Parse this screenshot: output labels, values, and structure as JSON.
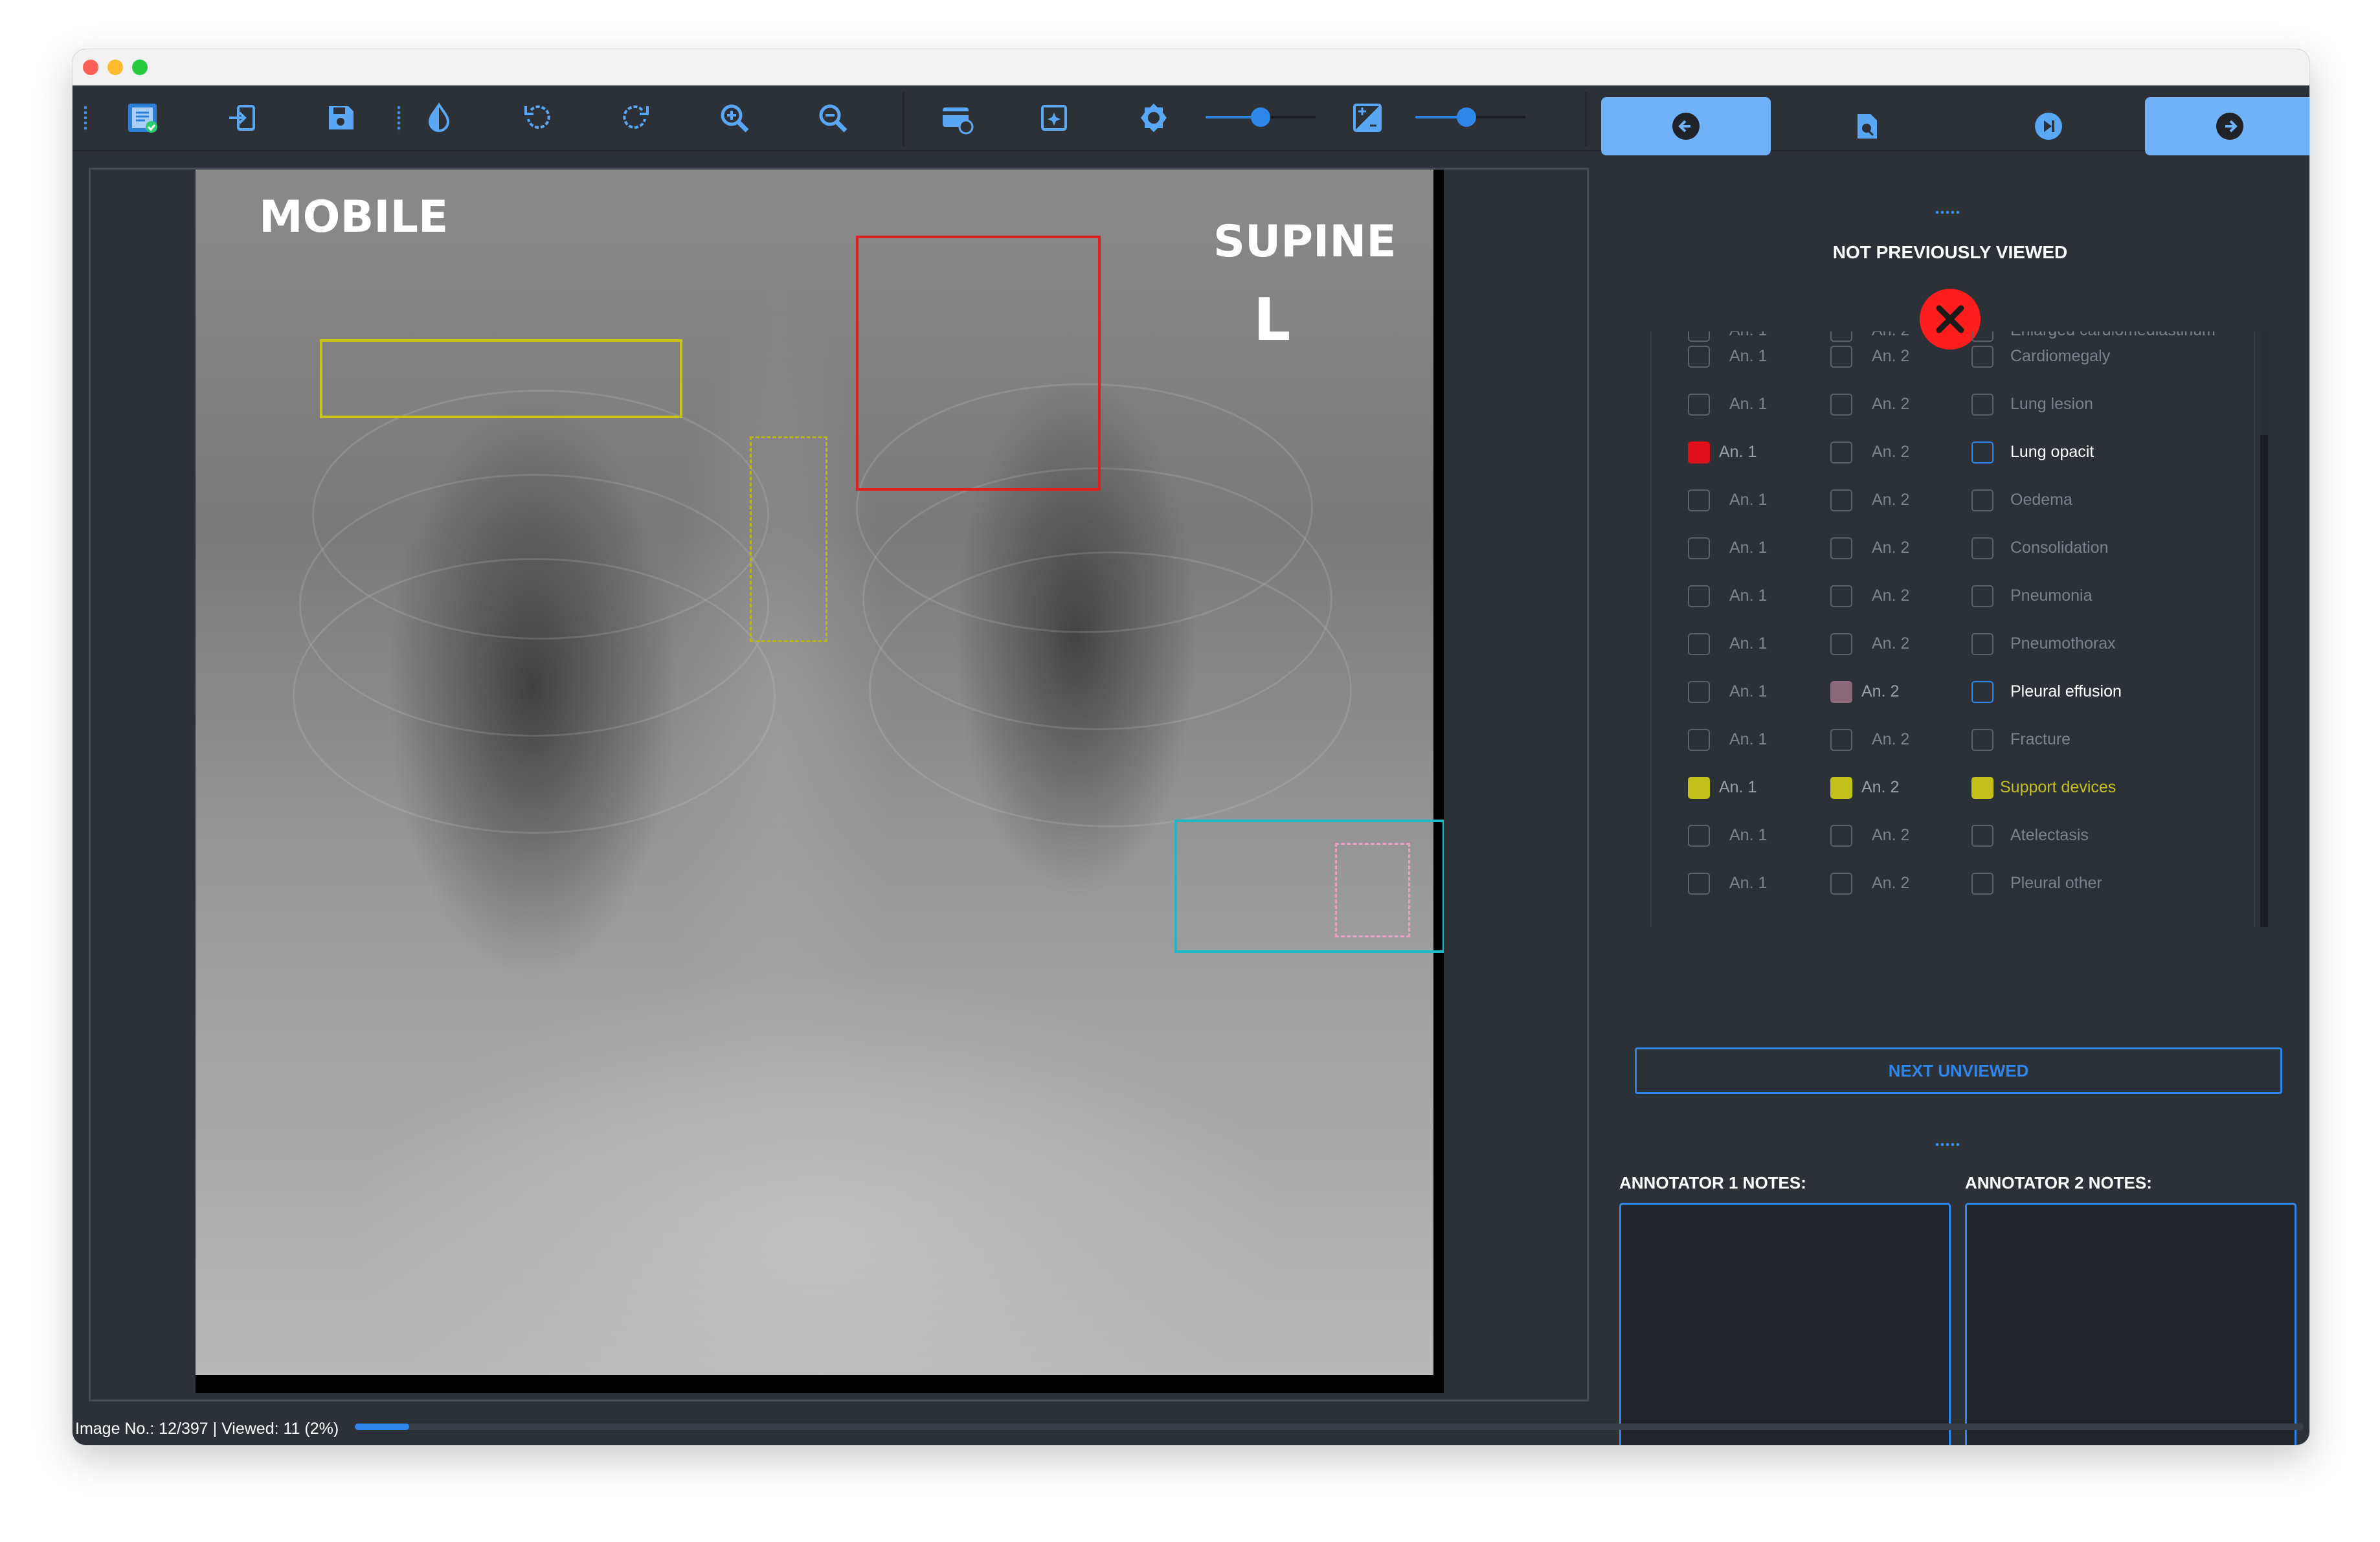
{
  "toolbar": {
    "icons": [
      "app-logo-icon",
      "export-icon",
      "save-icon",
      "contrast-icon",
      "rotate-left-icon",
      "rotate-right-icon",
      "zoom-in-icon",
      "zoom-out-icon",
      "reset-view-icon",
      "ai-detect-icon",
      "brightness-icon",
      "exposure-icon"
    ],
    "brightness_level": 0.5,
    "contrast_level": 0.46
  },
  "nav": {
    "prev_icon": "arrow-left-icon",
    "search_icon": "search-image-icon",
    "skip_icon": "skip-next-icon",
    "next_icon": "arrow-right-icon"
  },
  "image": {
    "label_mobile": "MOBILE",
    "label_supine": "SUPINE",
    "label_side": "L",
    "annotation_colors": {
      "red": "#e02020",
      "yellow": "#c8c41a",
      "yellow_dashed": "#b8b420",
      "cyan": "#1fb8c8",
      "pink_dashed": "#e8a0c8"
    }
  },
  "status": {
    "title": "NOT PREVIOUSLY VIEWED",
    "icon": "x-circle-icon",
    "color": "#ff1d1d"
  },
  "findings": {
    "partial_top_label": "Enlarged cardiomediastinum",
    "an1_label": "An. 1",
    "an2_label": "An. 2",
    "rows": [
      {
        "label": "Cardiomegaly",
        "an1": "",
        "an2": "",
        "active": false
      },
      {
        "label": "Lung lesion",
        "an1": "",
        "an2": "",
        "active": false
      },
      {
        "label": "Lung opacit",
        "an1": "#e0101a",
        "an2": "",
        "active": true
      },
      {
        "label": "Oedema",
        "an1": "",
        "an2": "",
        "active": false
      },
      {
        "label": "Consolidation",
        "an1": "",
        "an2": "",
        "active": false
      },
      {
        "label": "Pneumonia",
        "an1": "",
        "an2": "",
        "active": false
      },
      {
        "label": "Pneumothorax",
        "an1": "",
        "an2": "",
        "active": false
      },
      {
        "label": "Pleural effusion",
        "an1": "",
        "an2": "#8a6a78",
        "active": true
      },
      {
        "label": "Fracture",
        "an1": "",
        "an2": "",
        "active": false
      },
      {
        "label": "Support devices",
        "an1": "#c4c01a",
        "an2": "#c4c01a",
        "active": false,
        "label_color": "#c4c01a"
      },
      {
        "label": "Atelectasis",
        "an1": "",
        "an2": "",
        "active": false
      },
      {
        "label": "Pleural other",
        "an1": "",
        "an2": "",
        "active": false
      }
    ]
  },
  "next_unviewed": "NEXT UNVIEWED",
  "notes": {
    "annotator1_label": "ANNOTATOR 1 NOTES:",
    "annotator2_label": "ANNOTATOR 2 NOTES:"
  },
  "statusbar": {
    "text": "Image No.: 12/397 | Viewed: 11 (2%)",
    "progress_fraction": 0.028
  }
}
